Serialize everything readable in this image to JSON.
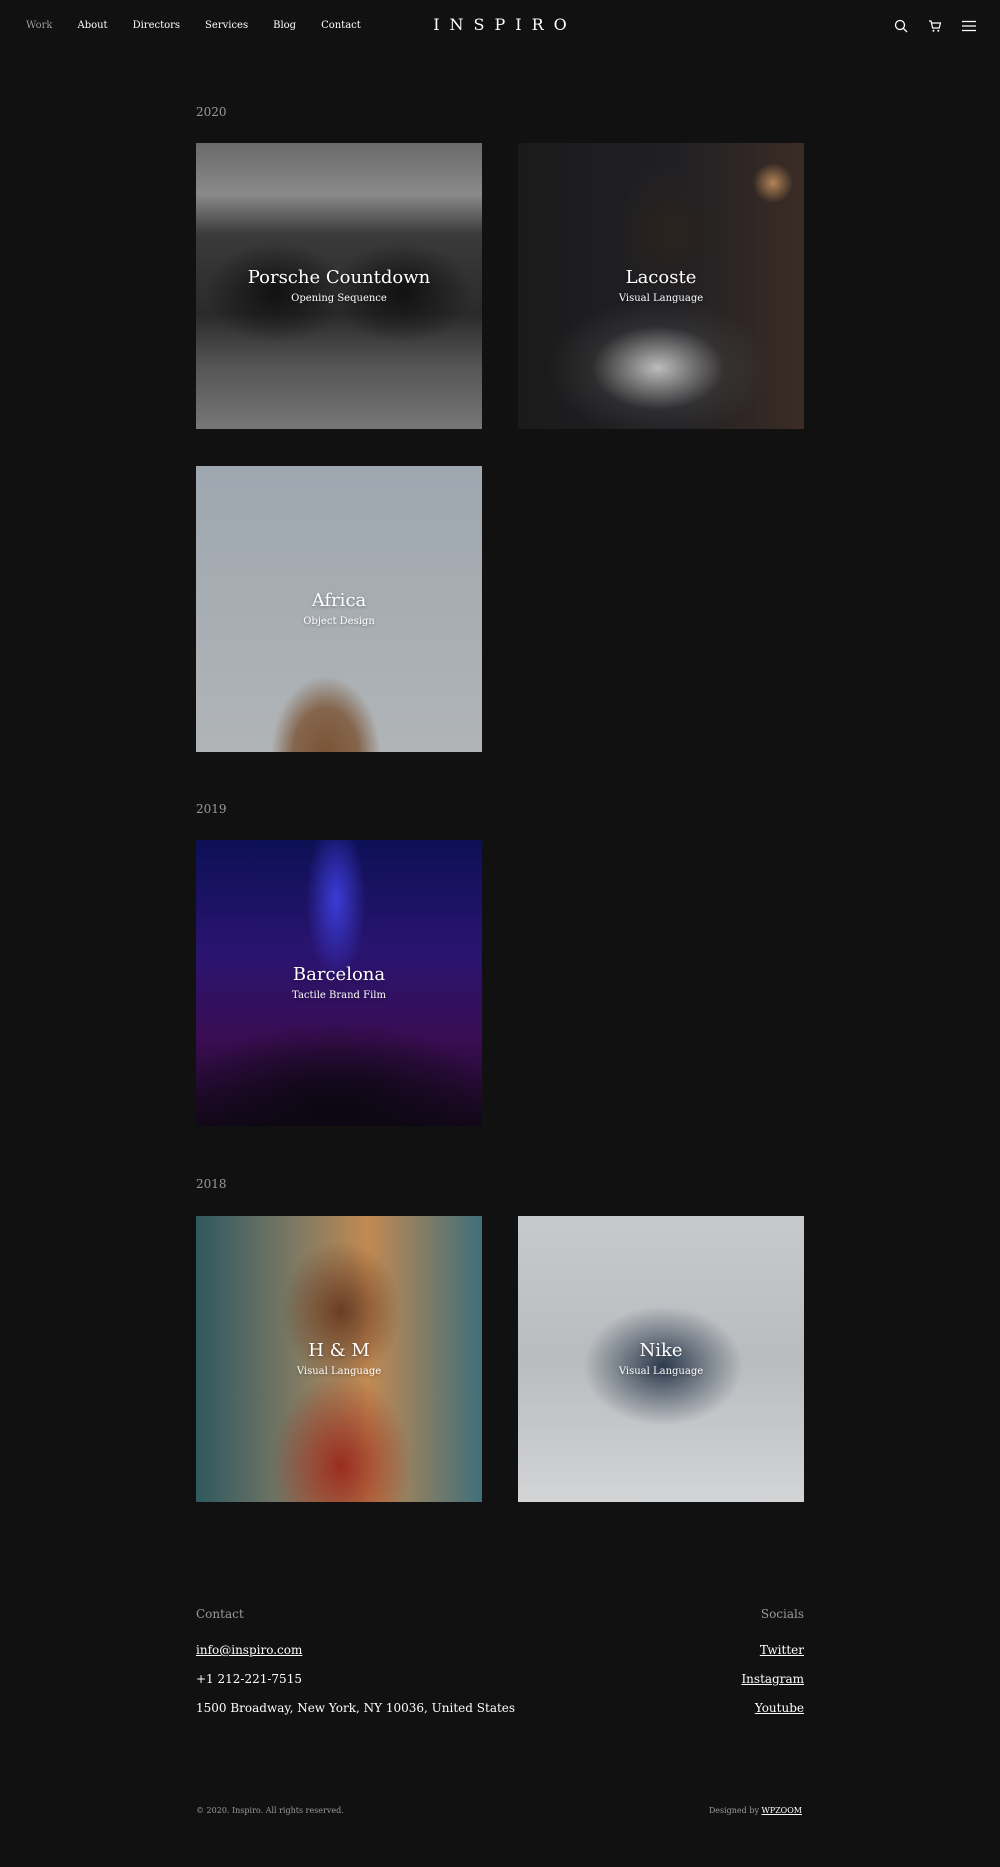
{
  "header": {
    "nav": [
      "Work",
      "About",
      "Directors",
      "Services",
      "Blog",
      "Contact"
    ],
    "active_nav": "Work",
    "logo": "INSPIRO",
    "icons": [
      "search-icon",
      "cart-icon",
      "menu-icon"
    ]
  },
  "sections": [
    {
      "year": "2020",
      "items": [
        {
          "title": "Porsche Countdown",
          "subtitle": "Opening Sequence"
        },
        {
          "title": "Lacoste",
          "subtitle": "Visual Language"
        },
        {
          "title": "Africa",
          "subtitle": "Object Design"
        }
      ]
    },
    {
      "year": "2019",
      "items": [
        {
          "title": "Barcelona",
          "subtitle": "Tactile Brand Film"
        }
      ]
    },
    {
      "year": "2018",
      "items": [
        {
          "title": "H & M",
          "subtitle": "Visual Language"
        },
        {
          "title": "Nike",
          "subtitle": "Visual Language"
        }
      ]
    }
  ],
  "footer": {
    "contact_heading": "Contact",
    "email": "info@inspiro.com",
    "phone": "+1 212-221-7515",
    "address": "1500 Broadway, New York, NY 10036, United States",
    "socials_heading": "Socials",
    "socials": [
      "Twitter",
      "Instagram",
      "Youtube"
    ],
    "copyright": "© 2020. Inspiro. All rights reserved.",
    "designed_by_prefix": "Designed by",
    "designed_by_link": "WPZOOM"
  }
}
